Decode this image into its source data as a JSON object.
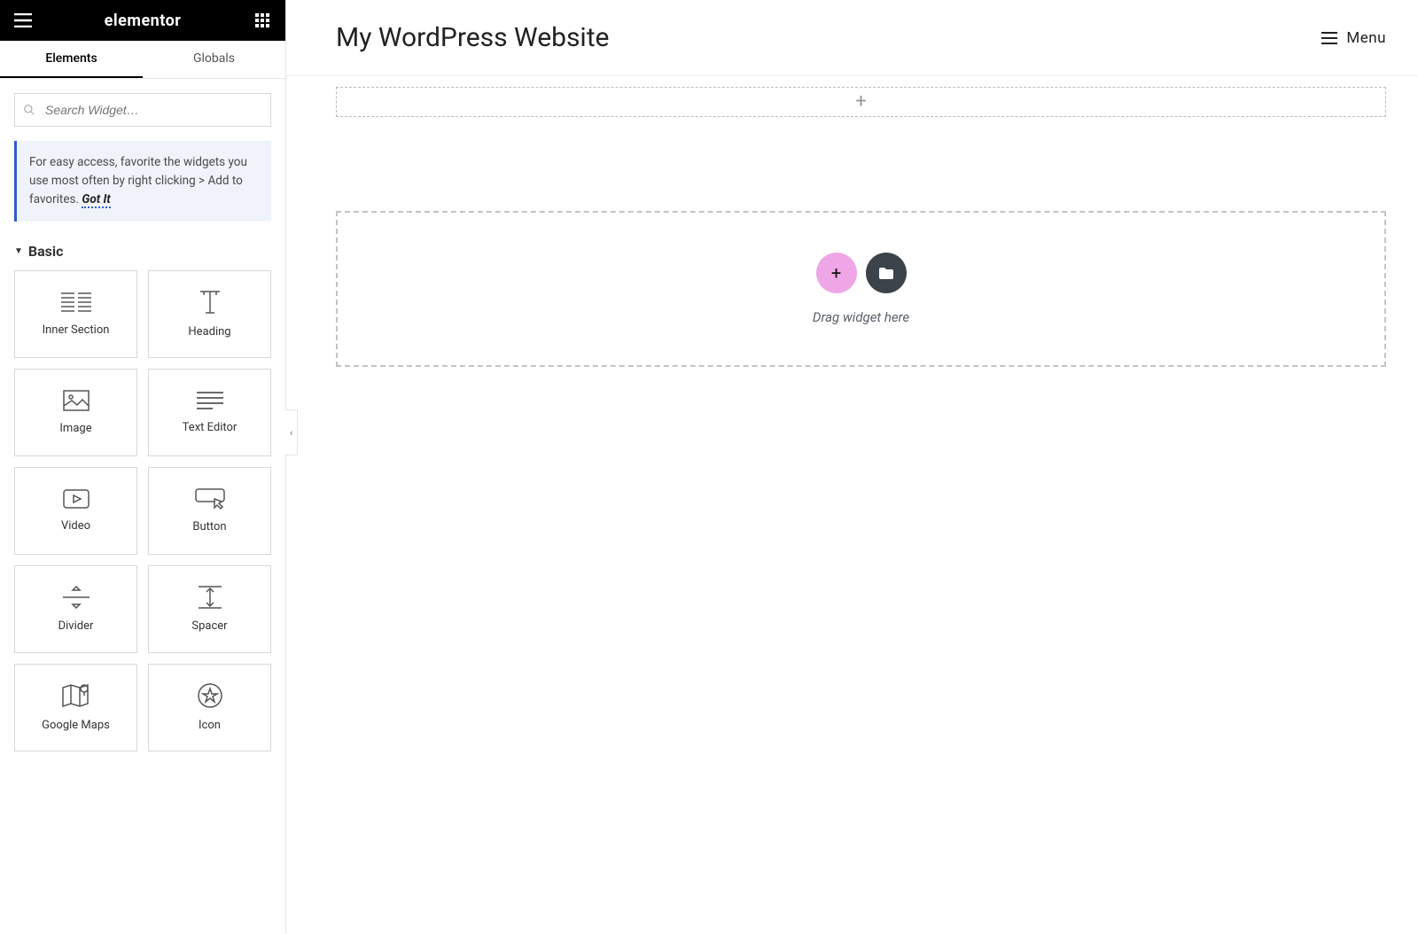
{
  "brand": "elementor",
  "tabs": {
    "elements": "Elements",
    "globals": "Globals"
  },
  "search": {
    "placeholder": "Search Widget…"
  },
  "tip": {
    "text": "For easy access, favorite the widgets you use most often by right clicking > Add to favorites.",
    "gotit": "Got It"
  },
  "category": {
    "label": "Basic"
  },
  "widgets": [
    {
      "id": "inner-section",
      "label": "Inner Section"
    },
    {
      "id": "heading",
      "label": "Heading"
    },
    {
      "id": "image",
      "label": "Image"
    },
    {
      "id": "text-editor",
      "label": "Text Editor"
    },
    {
      "id": "video",
      "label": "Video"
    },
    {
      "id": "button",
      "label": "Button"
    },
    {
      "id": "divider",
      "label": "Divider"
    },
    {
      "id": "spacer",
      "label": "Spacer"
    },
    {
      "id": "google-maps",
      "label": "Google Maps"
    },
    {
      "id": "icon",
      "label": "Icon"
    }
  ],
  "topbar": {
    "title": "My WordPress Website",
    "menu": "Menu"
  },
  "dropzone": {
    "text": "Drag widget here"
  }
}
